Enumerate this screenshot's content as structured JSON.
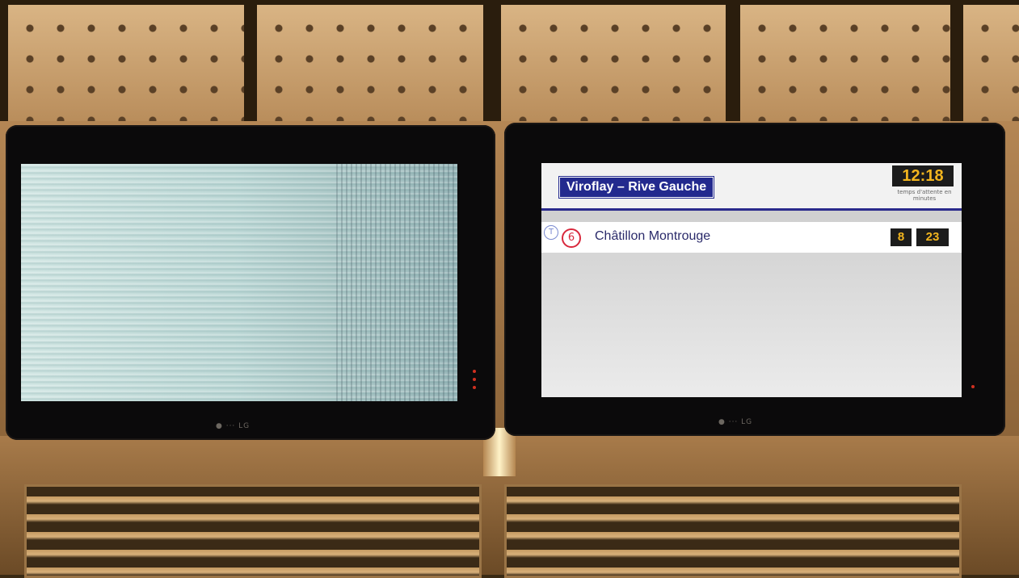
{
  "right_display": {
    "station": "Viroflay – Rive Gauche",
    "clock": "12:18",
    "wait_label": "temps d'attente en minutes",
    "rows": [
      {
        "icon": "T",
        "line": "6",
        "destination": "Châtillon Montrouge",
        "times": [
          "8",
          "23"
        ]
      }
    ]
  },
  "colors": {
    "station_bg": "#232a8e",
    "clock_text": "#f2b51e",
    "line_badge": "#d8283c"
  }
}
